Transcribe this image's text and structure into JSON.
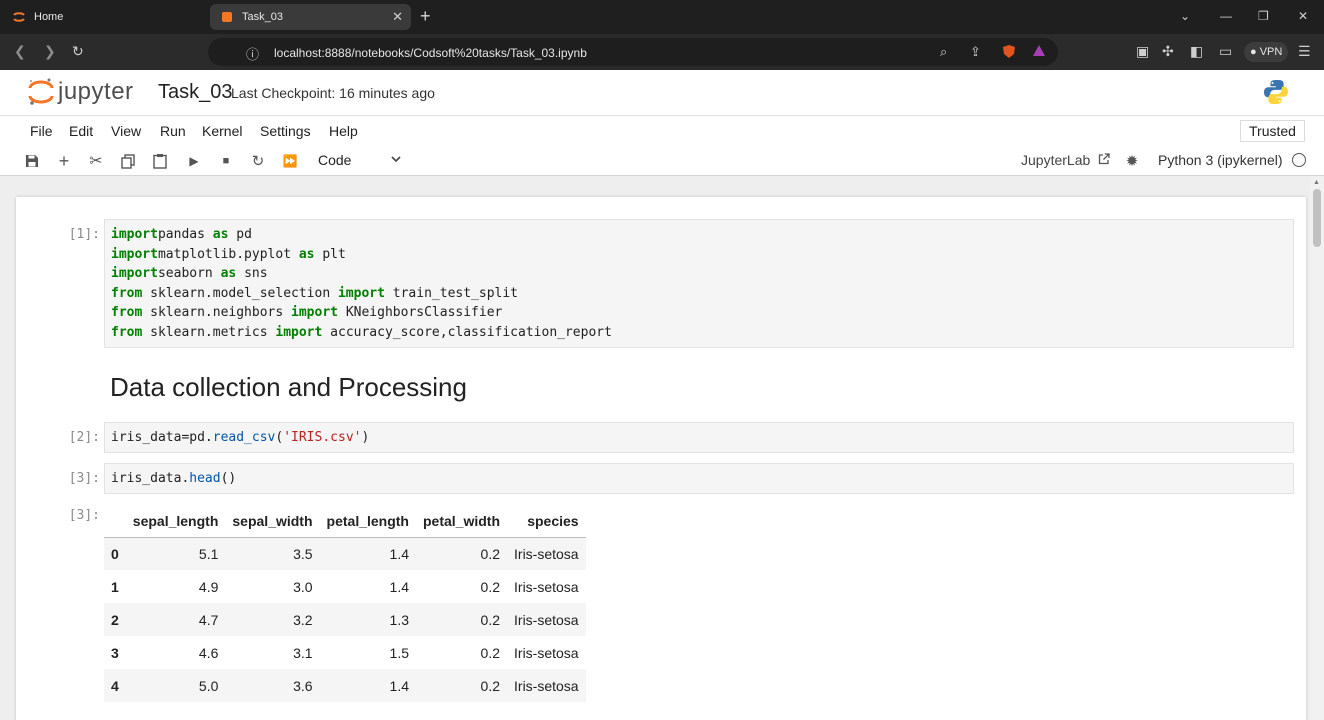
{
  "browser": {
    "tabs": [
      {
        "label": "Home",
        "active": false
      },
      {
        "label": "Task_03",
        "active": true
      }
    ],
    "url": "localhost:8888/notebooks/Codsoft%20tasks/Task_03.ipynb",
    "vpn_label": "VPN"
  },
  "header": {
    "logo_text": "jupyter",
    "notebook_title": "Task_03",
    "checkpoint": "Last Checkpoint: 16 minutes ago"
  },
  "menu": {
    "items": [
      "File",
      "Edit",
      "View",
      "Run",
      "Kernel",
      "Settings",
      "Help"
    ],
    "trusted": "Trusted"
  },
  "toolbar": {
    "cell_type": "Code",
    "jupyterlab_link": "JupyterLab",
    "kernel": "Python 3 (ipykernel)"
  },
  "notebook": {
    "cell1_prompt": "[1]:",
    "cell1_lines": [
      [
        [
          "kw",
          "import"
        ],
        [
          "",
          "pandas "
        ],
        [
          "kw",
          "as"
        ],
        [
          "",
          " pd"
        ]
      ],
      [
        [
          "kw",
          "import"
        ],
        [
          "",
          "matplotlib.pyplot "
        ],
        [
          "kw",
          "as"
        ],
        [
          "",
          " plt"
        ]
      ],
      [
        [
          "kw",
          "import"
        ],
        [
          "",
          "seaborn "
        ],
        [
          "kw",
          "as"
        ],
        [
          "",
          " sns"
        ]
      ],
      [
        [
          "kw",
          "from"
        ],
        [
          "",
          " sklearn.model_selection "
        ],
        [
          "kw",
          "import"
        ],
        [
          "",
          " train_test_split"
        ]
      ],
      [
        [
          "kw",
          "from"
        ],
        [
          "",
          " sklearn.neighbors "
        ],
        [
          "kw",
          "import"
        ],
        [
          "",
          " KNeighborsClassifier"
        ]
      ],
      [
        [
          "kw",
          "from"
        ],
        [
          "",
          " sklearn.metrics "
        ],
        [
          "kw",
          "import"
        ],
        [
          "",
          " accuracy_score,classification_report"
        ]
      ]
    ],
    "markdown_heading": "Data collection and Processing",
    "cell2_prompt": "[2]:",
    "cell2_parts": [
      [
        "",
        "iris_data=pd."
      ],
      [
        "fn",
        "read_csv"
      ],
      [
        "",
        "("
      ],
      [
        "st",
        "'IRIS.csv'"
      ],
      [
        "",
        ")"
      ]
    ],
    "cell3_prompt": "[3]:",
    "cell3_parts": [
      [
        "",
        "iris_data."
      ],
      [
        "fn",
        "head"
      ],
      [
        "",
        "()"
      ]
    ],
    "out3_prompt": "[3]:",
    "table": {
      "columns": [
        "",
        "sepal_length",
        "sepal_width",
        "petal_length",
        "petal_width",
        "species"
      ],
      "rows": [
        [
          "0",
          "5.1",
          "3.5",
          "1.4",
          "0.2",
          "Iris-setosa"
        ],
        [
          "1",
          "4.9",
          "3.0",
          "1.4",
          "0.2",
          "Iris-setosa"
        ],
        [
          "2",
          "4.7",
          "3.2",
          "1.3",
          "0.2",
          "Iris-setosa"
        ],
        [
          "3",
          "4.6",
          "3.1",
          "1.5",
          "0.2",
          "Iris-setosa"
        ],
        [
          "4",
          "5.0",
          "3.6",
          "1.4",
          "0.2",
          "Iris-setosa"
        ]
      ]
    }
  }
}
